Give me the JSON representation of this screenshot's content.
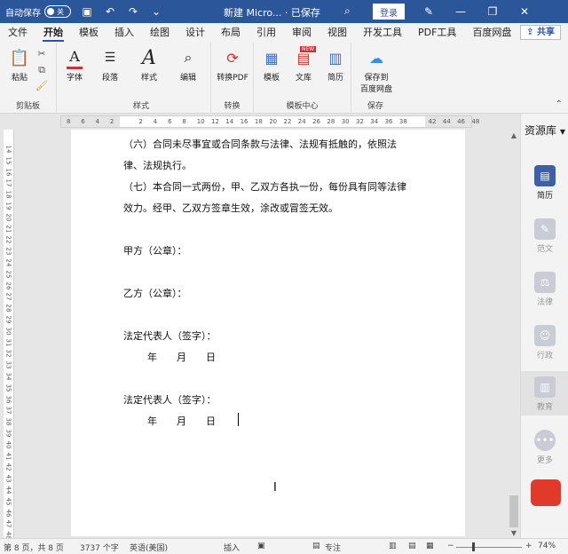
{
  "titlebar": {
    "autosave_label": "自动保存",
    "autosave_state": "关",
    "title": "新建 Micro... · 已保存",
    "login": "登录",
    "icons": [
      "save-icon",
      "undo-icon",
      "redo-icon",
      "customize-icon"
    ]
  },
  "tabs": [
    "文件",
    "开始",
    "模板",
    "插入",
    "绘图",
    "设计",
    "布局",
    "引用",
    "审阅",
    "视图",
    "开发工具",
    "PDF工具",
    "百度网盘"
  ],
  "active_tab": "开始",
  "share": "共享",
  "ribbon": {
    "paste": "粘贴",
    "clipboard": "剪贴板",
    "font": "字体",
    "paragraph": "段落",
    "styles": "样式",
    "styles_group": "样式",
    "edit": "编辑",
    "convert_pdf": "转换PDF",
    "convert_group": "转换",
    "template": "模板",
    "library": "文库",
    "resume": "简历",
    "template_center": "模板中心",
    "save_baidu": "保存到\n百度网盘",
    "save_group": "保存",
    "new_badge": "NEW"
  },
  "ruler": {
    "ticks": [
      "8",
      "6",
      "4",
      "2",
      "",
      "2",
      "4",
      "6",
      "8",
      "10",
      "12",
      "14",
      "16",
      "18",
      "20",
      "22",
      "24",
      "26",
      "28",
      "30",
      "32",
      "34",
      "36",
      "38",
      "",
      "42",
      "44",
      "46",
      "48"
    ],
    "left_ticks": [
      "14",
      "15",
      "16",
      "17",
      "18",
      "19",
      "20",
      "21",
      "22",
      "23",
      "24",
      "25",
      "26",
      "27",
      "28",
      "29",
      "30",
      "31",
      "32",
      "33",
      "34",
      "35",
      "36",
      "37",
      "38",
      "39",
      "40",
      "41",
      "42",
      "43",
      "44",
      "45",
      "46",
      "47",
      "48"
    ]
  },
  "document": {
    "lines": [
      "（六）合同未尽事宜或合同条款与法律、法规有抵触的，依照法",
      "律、法规执行。",
      "（七）本合同一式两份，甲、乙双方各执一份，每份具有同等法律",
      "效力。经甲、乙双方签章生效，涂改或冒签无效。",
      "甲方（公章）：",
      "乙方（公章）：",
      "法定代表人（签字）：",
      "年　　月　　日",
      "法定代表人（签字）：",
      "年　　月　　日"
    ]
  },
  "pane": {
    "title": "资源库",
    "items": [
      "简历",
      "范文",
      "法律",
      "行政",
      "教育",
      "更多"
    ]
  },
  "status": {
    "page": "第 8 页，共 8 页",
    "words": "3737 个字",
    "lang": "英语(美国)",
    "insert": "插入",
    "focus": "专注",
    "zoom": "74%"
  }
}
